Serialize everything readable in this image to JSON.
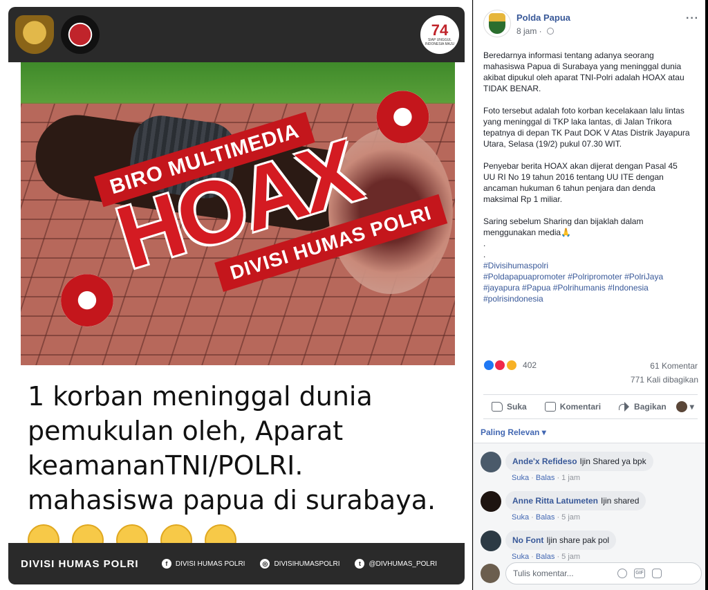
{
  "photo": {
    "badge_74_number": "74",
    "badge_74_sub": "SIAP UNGGUL INDONESIA MAJU",
    "stamp_top": "BIRO MULTIMEDIA",
    "stamp_main": "HOAX",
    "stamp_bottom": "DIVISI HUMAS POLRI",
    "caption_lines": [
      "1 korban meninggal dunia",
      "pemukulan oleh, Aparat",
      "keamananTNI/POLRI.",
      "mahasiswa papua di surabaya."
    ],
    "bottom_brand": "DIVISI HUMAS POLRI",
    "social": [
      {
        "icon": "facebook-icon",
        "glyph": "f",
        "label": "DIVISI HUMAS POLRI"
      },
      {
        "icon": "instagram-icon",
        "glyph": "◎",
        "label": "DIVISIHUMASPOLRI"
      },
      {
        "icon": "twitter-icon",
        "glyph": "t",
        "label": "@DIVHUMAS_POLRI"
      }
    ]
  },
  "post": {
    "page_name": "Polda Papua",
    "time": "8 jam",
    "paragraphs": [
      "Beredarnya informasi tentang adanya seorang mahasiswa Papua di Surabaya yang meninggal dunia akibat dipukul oleh aparat TNI-Polri adalah HOAX atau TIDAK BENAR.",
      "Foto tersebut adalah foto korban kecelakaan lalu lintas yang meninggal di TKP laka lantas, di Jalan Trikora tepatnya di depan TK Paut DOK V Atas Distrik Jayapura Utara, Selasa (19/2) pukul 07.30 WIT.",
      "Penyebar berita HOAX akan dijerat dengan Pasal 45 UU RI No 19 tahun 2016 tentang UU ITE dengan ancaman hukuman 6 tahun penjara dan denda maksimal Rp 1 miliar.",
      "Saring sebelum Sharing dan bijaklah dalam menggunakan media🙏"
    ],
    "dots": [
      ".",
      "."
    ],
    "hashtags_lines": [
      "#Divisihumaspolri",
      "#Poldapapuapromoter #Polripromoter #PolriJaya",
      "#jayapura #Papua #Polrihumanis #Indonesia",
      "#polrisindonesia"
    ],
    "reaction_count": "402",
    "comment_count": "61 Komentar",
    "share_count": "771 Kali dibagikan",
    "actions": {
      "like": "Suka",
      "comment": "Komentari",
      "share": "Bagikan"
    },
    "sort_label": "Paling Relevan",
    "sort_caret": "▾",
    "audience_caret": "▾"
  },
  "comments": [
    {
      "name": "Ande'x Refideso",
      "text": "Ijin Shared ya bpk",
      "like": "Suka",
      "reply": "Balas",
      "time": "1 jam",
      "avatar_color": "#4a5a6a"
    },
    {
      "name": "Anne Ritta Latumeten",
      "text": "Ijin shared",
      "like": "Suka",
      "reply": "Balas",
      "time": "5 jam",
      "avatar_color": "#1e1410"
    },
    {
      "name": "No Font",
      "text": "Ijin share pak pol",
      "like": "Suka",
      "reply": "Balas",
      "time": "5 jam",
      "avatar_color": "#2c3a44"
    }
  ],
  "composer": {
    "placeholder": "Tulis komentar...",
    "gif_label": "GIF"
  },
  "colors": {
    "link_blue": "#385898",
    "hoax_red": "#d41b22",
    "bar_dark": "#2a2a2a"
  }
}
